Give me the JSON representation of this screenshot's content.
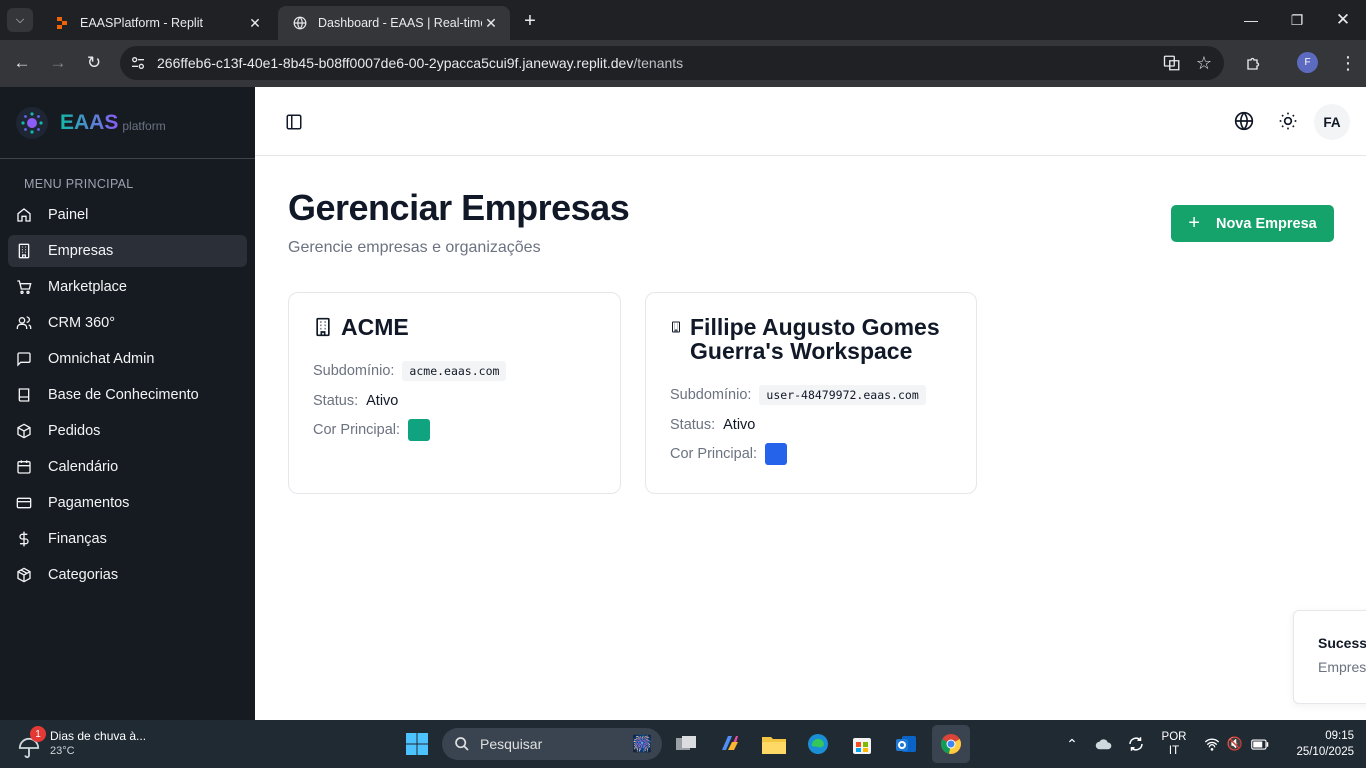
{
  "browser": {
    "tabs": [
      {
        "title": "EAASPlatform - Replit",
        "active": false
      },
      {
        "title": "Dashboard - EAAS | Real-time E",
        "active": true
      }
    ],
    "url_host": "266ffeb6-c13f-40e1-8b45-b08ff0007de6-00-2ypacca5cui9f.janeway.replit.dev",
    "url_path": "/tenants",
    "profile_initial": "F"
  },
  "sidebar": {
    "brand_name": "EAAS",
    "brand_sub": "platform",
    "menu_title": "MENU PRINCIPAL",
    "items": [
      {
        "label": "Painel",
        "icon": "home-icon"
      },
      {
        "label": "Empresas",
        "icon": "building-icon",
        "active": true
      },
      {
        "label": "Marketplace",
        "icon": "cart-icon"
      },
      {
        "label": "CRM 360°",
        "icon": "users-icon"
      },
      {
        "label": "Omnichat Admin",
        "icon": "chat-icon"
      },
      {
        "label": "Base de Conhecimento",
        "icon": "book-icon"
      },
      {
        "label": "Pedidos",
        "icon": "package-icon"
      },
      {
        "label": "Calendário",
        "icon": "calendar-icon"
      },
      {
        "label": "Pagamentos",
        "icon": "credit-card-icon"
      },
      {
        "label": "Finanças",
        "icon": "dollar-icon"
      },
      {
        "label": "Categorias",
        "icon": "box-icon"
      }
    ]
  },
  "header": {
    "avatar_initials": "FA"
  },
  "main": {
    "title": "Gerenciar Empresas",
    "subtitle": "Gerencie empresas e organizações",
    "new_button_label": "Nova Empresa",
    "labels": {
      "subdomain": "Subdomínio:",
      "status": "Status:",
      "color": "Cor Principal:"
    },
    "companies": [
      {
        "name": "ACME",
        "subdomain": "acme.eaas.com",
        "status": "Ativo",
        "color": "#10a37f"
      },
      {
        "name": "Fillipe Augusto Gomes Guerra's Workspace",
        "subdomain": "user-48479972.eaas.com",
        "status": "Ativo",
        "color": "#2563eb"
      }
    ]
  },
  "toast": {
    "title": "Sucess",
    "message": "Empres"
  },
  "taskbar": {
    "weather_badge": "1",
    "weather_text": "Dias de chuva à...",
    "weather_temp": "23°C",
    "search_placeholder": "Pesquisar",
    "lang_line1": "POR",
    "lang_line2": "IT",
    "time": "09:15",
    "date": "25/10/2025"
  },
  "colors": {
    "accent_green": "#16a36b",
    "sidebar_bg": "#161b22"
  }
}
